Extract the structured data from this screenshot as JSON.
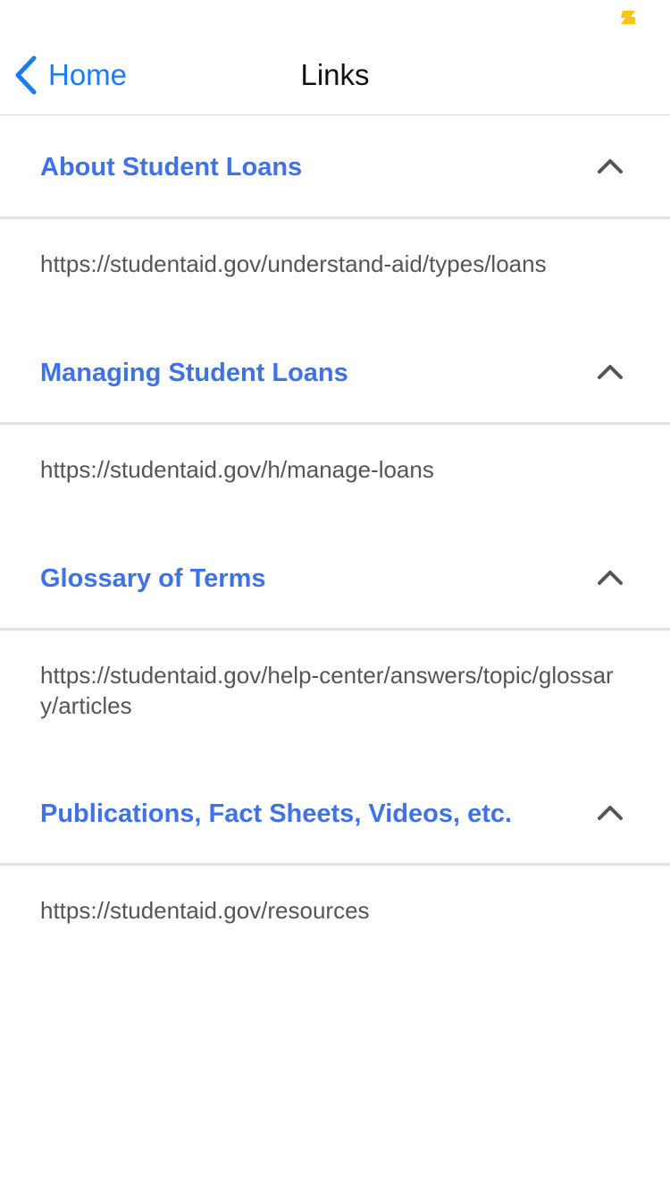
{
  "status_bar": {
    "battery_icon": "battery-low-icon",
    "battery_color": "#f5c518"
  },
  "nav": {
    "back_label": "Home",
    "back_icon": "chevron-left-icon",
    "title": "Links",
    "accent_color": "#1a7cf5"
  },
  "sections": [
    {
      "title": "About Student Loans",
      "link": "https://studentaid.gov/understand-aid/types/loans",
      "expanded": true,
      "toggle_icon": "chevron-up-icon"
    },
    {
      "title": "Managing Student Loans",
      "link": "https://studentaid.gov/h/manage-loans",
      "expanded": true,
      "toggle_icon": "chevron-up-icon"
    },
    {
      "title": "Glossary of Terms",
      "link": "https://studentaid.gov/help-center/answers/topic/glossary/articles",
      "expanded": true,
      "toggle_icon": "chevron-up-icon"
    },
    {
      "title": "Publications, Fact Sheets, Videos, etc.",
      "link": "https://studentaid.gov/resources",
      "expanded": true,
      "toggle_icon": "chevron-up-icon"
    }
  ],
  "colors": {
    "section_title": "#3e72e6",
    "link_text": "#555555",
    "divider": "#e3e3e3"
  }
}
